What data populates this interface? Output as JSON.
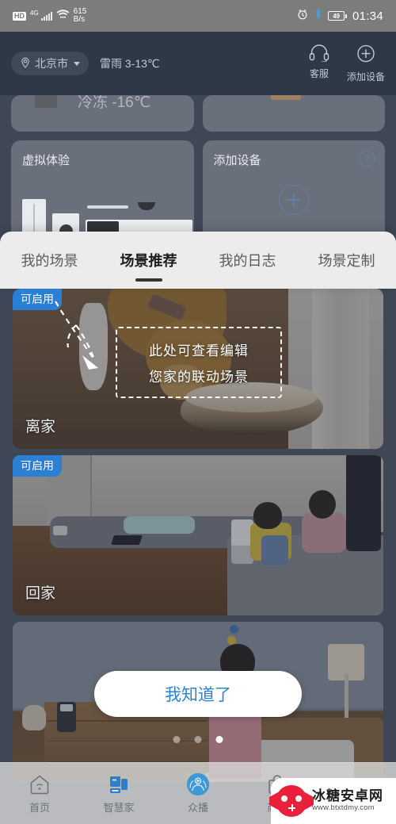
{
  "status_bar": {
    "hd_label": "HD",
    "network": "4G",
    "speed_value": "615",
    "speed_unit": "B/s",
    "alarm_icon": "alarm-clock-icon",
    "bluetooth_icon": "bluetooth-icon",
    "battery_percent": "49",
    "time": "01:34"
  },
  "header": {
    "location": "北京市",
    "weather": "雷雨 3-13℃",
    "actions": [
      {
        "label": "客服",
        "icon": "headset-icon"
      },
      {
        "label": "添加设备",
        "icon": "plus-circle-icon"
      }
    ]
  },
  "tiles": {
    "cut_card_label": "冷冻 -16℃",
    "virtual_experience": {
      "title": "虚拟体验"
    },
    "add_device": {
      "title": "添加设备",
      "help_icon": "question-mark-icon",
      "plus_icon": "plus-icon"
    }
  },
  "tabs": {
    "items": [
      {
        "label": "我的场景",
        "active": false
      },
      {
        "label": "场景推荐",
        "active": true
      },
      {
        "label": "我的日志",
        "active": false
      },
      {
        "label": "场景定制",
        "active": false
      }
    ]
  },
  "scenes": [
    {
      "badge": "可启用",
      "name": "离家"
    },
    {
      "badge": "可启用",
      "name": "回家"
    },
    {
      "badge": "",
      "name": ""
    }
  ],
  "annotation": {
    "line1": "此处可查看编辑",
    "line2": "您家的联动场景",
    "arrow_icon": "dashed-arrow-icon"
  },
  "know_button": {
    "label": "我知道了"
  },
  "pagination": {
    "total": 3,
    "active_index": 2
  },
  "bottom_nav": {
    "items": [
      {
        "label": "首页",
        "icon": "home-wifi-icon",
        "active": false
      },
      {
        "label": "智慧家",
        "icon": "smart-home-icon",
        "active": true
      },
      {
        "label": "众播",
        "icon": "broadcast-icon",
        "active": false
      },
      {
        "label": "商城",
        "icon": "shopping-bag-icon",
        "active": false
      },
      {
        "label": "",
        "icon": "person-icon",
        "active": false
      }
    ]
  },
  "watermark": {
    "name": "冰糖安卓网",
    "url": "www.btxtdmy.com",
    "logo_icon": "candy-gamepad-icon"
  },
  "colors": {
    "status_bar_bg": "#7c7c7c",
    "header_bg": "#2e3846",
    "accent_blue": "#2a84d2",
    "badge_blue": "#2b7fd4",
    "tab_bg": "#ececec"
  }
}
